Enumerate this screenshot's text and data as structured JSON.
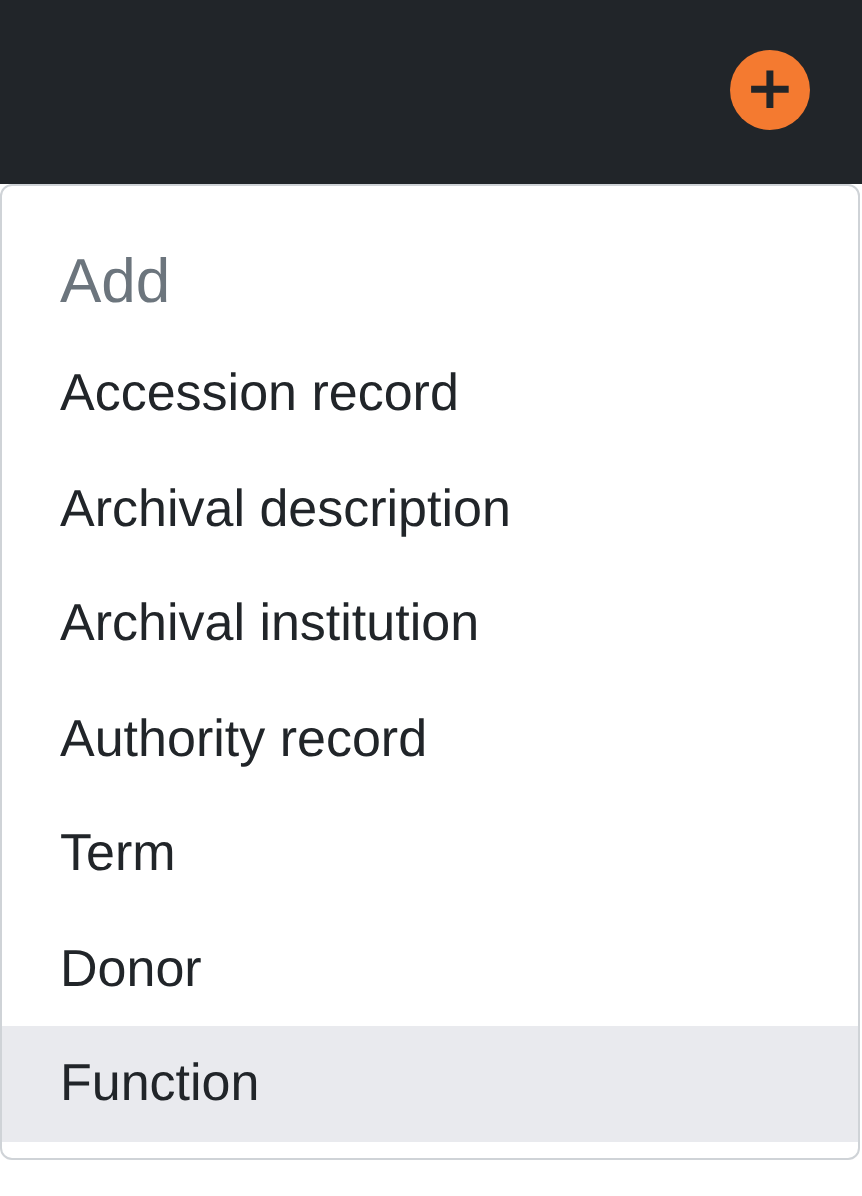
{
  "add_button": {
    "icon": "+"
  },
  "menu": {
    "header": "Add",
    "items": [
      {
        "label": "Accession record",
        "selected": false
      },
      {
        "label": "Archival description",
        "selected": false
      },
      {
        "label": "Archival institution",
        "selected": false
      },
      {
        "label": "Authority record",
        "selected": false
      },
      {
        "label": "Term",
        "selected": false
      },
      {
        "label": "Donor",
        "selected": false
      },
      {
        "label": "Function",
        "selected": true
      }
    ]
  }
}
